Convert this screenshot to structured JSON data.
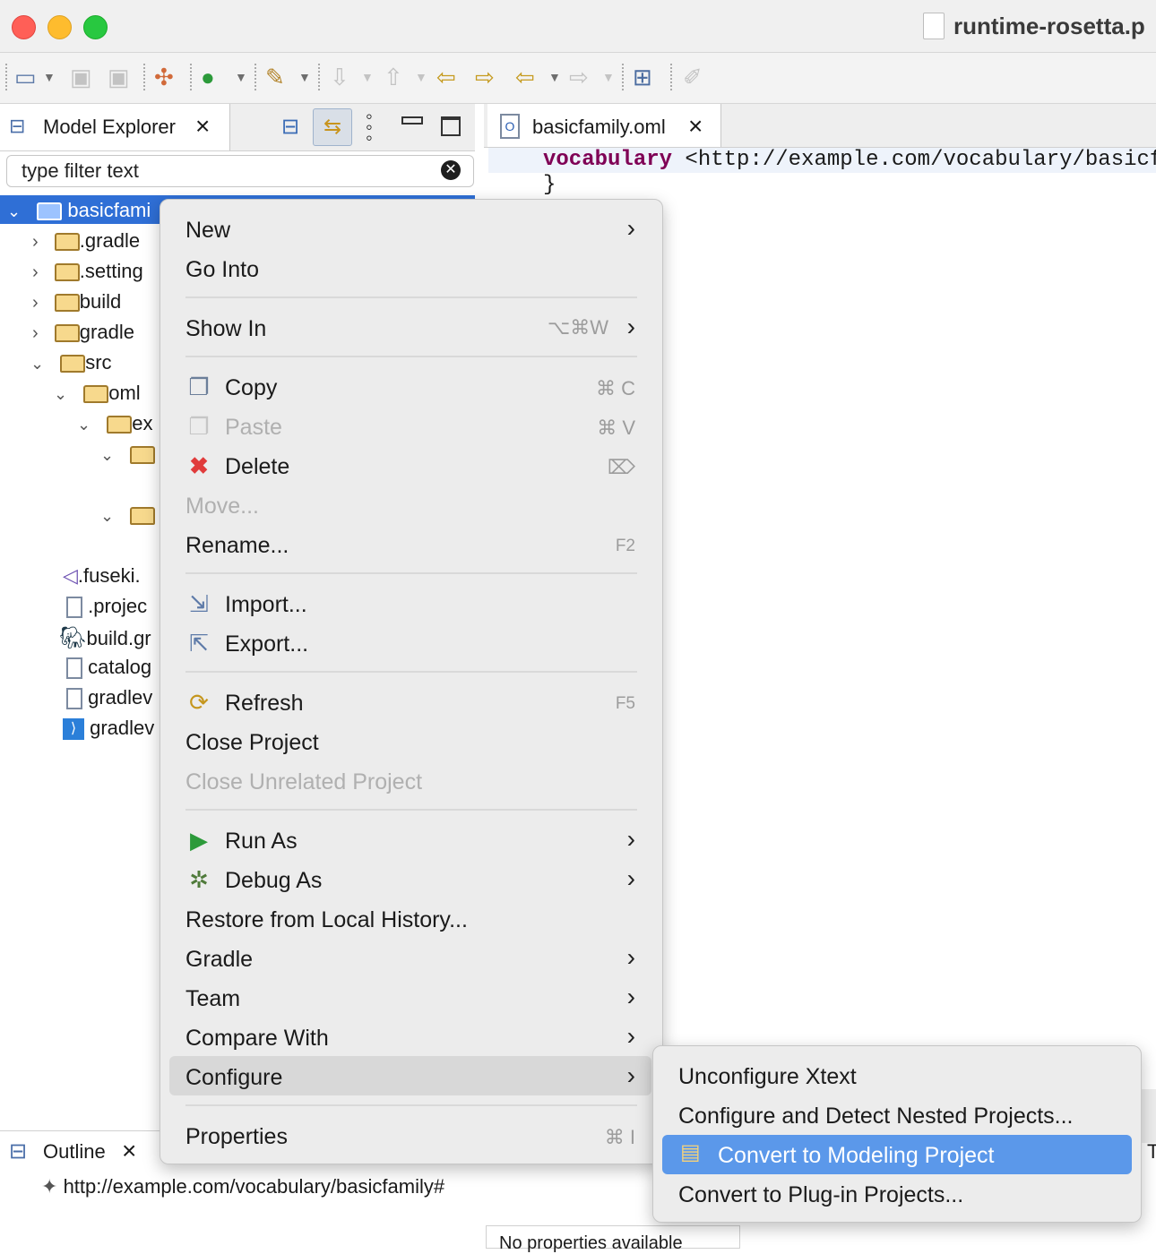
{
  "window": {
    "title": "runtime-rosetta.p",
    "colors": {
      "close": "#ff5f57",
      "minimize": "#febc2e",
      "maximize": "#28c840",
      "selection": "#2f6fd6",
      "highlight": "#5b98ea"
    }
  },
  "toolbar": {
    "icons": [
      "new-icon",
      "save-icon",
      "save-all-icon",
      "publish-icon",
      "run-icon",
      "build-icon",
      "next-annotation-icon",
      "previous-annotation-icon",
      "last-edit-icon",
      "back-icon",
      "forward-icon",
      "open-perspective-icon",
      "pen-icon"
    ]
  },
  "model_explorer": {
    "title": "Model Explorer",
    "filter_placeholder": "type filter text",
    "tree": [
      {
        "label": "basicfami",
        "selected": true
      },
      {
        "label": ".gradle"
      },
      {
        "label": ".setting"
      },
      {
        "label": "build"
      },
      {
        "label": "gradle"
      },
      {
        "label": "src"
      },
      {
        "label": "oml"
      },
      {
        "label": "ex"
      },
      {
        "label": ".fuseki."
      },
      {
        "label": ".projec"
      },
      {
        "label": "build.gr"
      },
      {
        "label": "catalog"
      },
      {
        "label": "gradlev"
      },
      {
        "label": "gradlev"
      }
    ]
  },
  "editor": {
    "tab_label": "basicfamily.oml",
    "code_keyword": "vocabulary",
    "code_rest": " <http://example.com/vocabulary/basicf",
    "code_line2": "}"
  },
  "context_menu": {
    "items": [
      {
        "label": "New",
        "submenu": true
      },
      {
        "label": "Go Into"
      },
      {
        "label": "Show In",
        "shortcut": "⌥⌘W",
        "submenu": true
      },
      {
        "label": "Copy",
        "shortcut": "⌘ C",
        "icon": "copy-icon"
      },
      {
        "label": "Paste",
        "shortcut": "⌘ V",
        "icon": "paste-icon",
        "disabled": true
      },
      {
        "label": "Delete",
        "shortcut": "⌦",
        "icon": "delete-icon"
      },
      {
        "label": "Move...",
        "disabled": true
      },
      {
        "label": "Rename...",
        "shortcut": "F2"
      },
      {
        "label": "Import...",
        "icon": "import-icon"
      },
      {
        "label": "Export...",
        "icon": "export-icon"
      },
      {
        "label": "Refresh",
        "shortcut": "F5",
        "icon": "refresh-icon"
      },
      {
        "label": "Close Project"
      },
      {
        "label": "Close Unrelated Project",
        "disabled": true
      },
      {
        "label": "Run As",
        "submenu": true,
        "icon": "run-as-icon"
      },
      {
        "label": "Debug As",
        "submenu": true,
        "icon": "debug-icon"
      },
      {
        "label": "Restore from Local History..."
      },
      {
        "label": "Gradle",
        "submenu": true
      },
      {
        "label": "Team",
        "submenu": true
      },
      {
        "label": "Compare With",
        "submenu": true
      },
      {
        "label": "Configure",
        "submenu": true,
        "highlighted": true
      },
      {
        "label": "Properties",
        "shortcut": "⌘ I"
      }
    ]
  },
  "configure_submenu": {
    "items": [
      {
        "label": "Unconfigure Xtext"
      },
      {
        "label": "Configure and Detect Nested Projects..."
      },
      {
        "label": "Convert to Modeling Project",
        "selected": true,
        "icon": "modeling-project-icon"
      },
      {
        "label": "Convert to Plug-in Projects..."
      }
    ]
  },
  "outline": {
    "title": "Outline",
    "item": "http://example.com/vocabulary/basicfamily#"
  },
  "properties": {
    "message": "No properties available"
  },
  "edge_letter": "T"
}
